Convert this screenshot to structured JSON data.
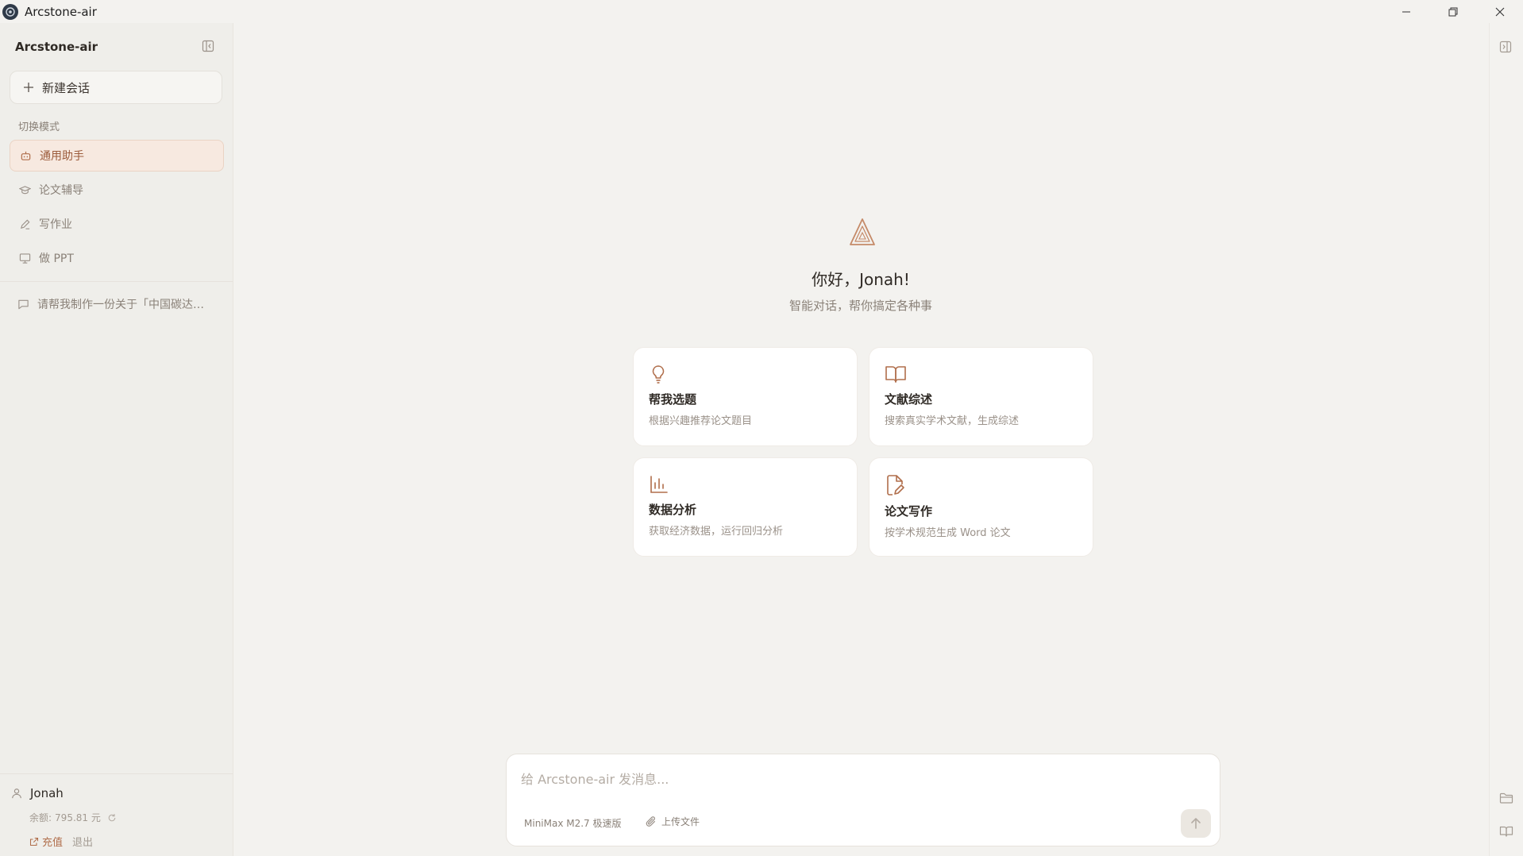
{
  "window": {
    "title": "Arcstone-air"
  },
  "sidebar": {
    "title": "Arcstone-air",
    "new_chat_label": "新建会话",
    "section_label": "切换模式",
    "modes": [
      {
        "label": "通用助手",
        "icon": "robot-icon",
        "active": true
      },
      {
        "label": "论文辅导",
        "icon": "graduation-cap-icon",
        "active": false
      },
      {
        "label": "写作业",
        "icon": "pencil-icon",
        "active": false
      },
      {
        "label": "做 PPT",
        "icon": "presentation-icon",
        "active": false
      }
    ],
    "history": [
      {
        "label": "请帮我制作一份关于「中国碳达…"
      }
    ],
    "user": {
      "name": "Jonah",
      "balance_label": "余额:",
      "balance_value": "795.81 元",
      "recharge_label": "充值",
      "logout_label": "退出"
    }
  },
  "main": {
    "greeting": "你好，Jonah!",
    "subtitle": "智能对话，帮你搞定各种事",
    "cards": [
      {
        "title": "帮我选题",
        "desc": "根据兴趣推荐论文题目",
        "icon": "lightbulb-icon"
      },
      {
        "title": "文献综述",
        "desc": "搜索真实学术文献，生成综述",
        "icon": "open-book-icon"
      },
      {
        "title": "数据分析",
        "desc": "获取经济数据，运行回归分析",
        "icon": "bar-chart-icon"
      },
      {
        "title": "论文写作",
        "desc": "按学术规范生成 Word 论文",
        "icon": "file-edit-icon"
      }
    ]
  },
  "composer": {
    "placeholder": "给 Arcstone-air 发消息...",
    "model_label": "MiniMax M2.7 极速版",
    "upload_label": "上传文件"
  },
  "colors": {
    "accent": "#b06e4b",
    "active_bg": "#f7e9e0",
    "background": "#f3f2ef",
    "sidebar_bg": "#efeeea"
  }
}
